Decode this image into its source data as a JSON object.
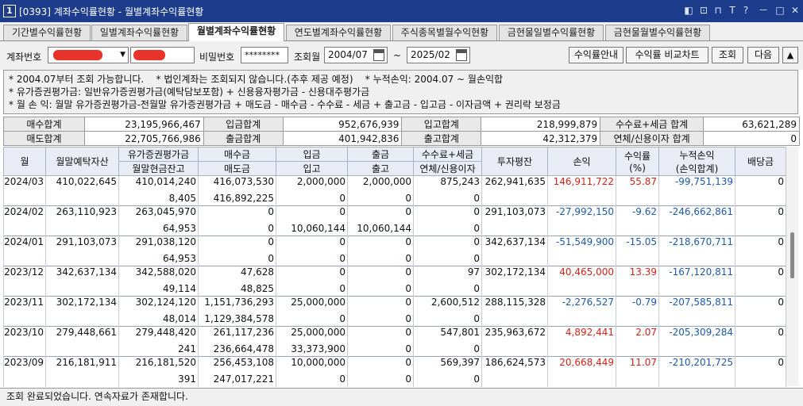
{
  "window": {
    "icon_text": "1",
    "title": "[0393] 계좌수익률현황 - 월별계좌수익률현황",
    "controls": [
      "◧",
      "⊡",
      "⊓",
      "T",
      "?",
      "－",
      "□",
      "✕"
    ]
  },
  "tabs": [
    {
      "label": "기간별수익률현황"
    },
    {
      "label": "일별계좌수익률현황"
    },
    {
      "label": "월별계좌수익률현황"
    },
    {
      "label": "연도별계좌수익률현황"
    },
    {
      "label": "주식종목별월수익현황"
    },
    {
      "label": "금현물일별수익률현황"
    },
    {
      "label": "금현물월별수익률현황"
    }
  ],
  "controls": {
    "account_label": "계좌번호",
    "password_label": "비밀번호",
    "password_value": "********",
    "period_label": "조회월",
    "date_from": "2004/07",
    "tilde": "~",
    "date_to": "2025/02",
    "btn_guide": "수익률안내",
    "btn_compare": "수익률 비교차트",
    "btn_query": "조회",
    "btn_next": "다음",
    "btn_up": "▲"
  },
  "notes": {
    "line1": "* 2004.07부터 조회 가능합니다.    * 법인계좌는 조회되지 않습니다.(추후 제공 예정)    * 누적손익: 2004.07 ~ 월손익합",
    "line2": "* 유가증권평가금: 일반유가증권평가금(예탁담보포함) + 신용융자평가금 - 신용대주평가금",
    "line3": "* 월 손 익: 월말 유가증권평가금-전월말 유가증권평가금 + 매도금 - 매수금 - 수수료 - 세금 + 출고금 - 입고금 - 이자금액 + 권리락 보정금"
  },
  "summary": {
    "row1": [
      {
        "label": "매수합계",
        "value": "23,195,966,467"
      },
      {
        "label": "입금합계",
        "value": "952,676,939"
      },
      {
        "label": "입고합계",
        "value": "218,999,879"
      },
      {
        "label": "수수료+세금 합계",
        "value": "63,621,289"
      }
    ],
    "row2": [
      {
        "label": "매도합계",
        "value": "22,705,766,986"
      },
      {
        "label": "출금합계",
        "value": "401,942,836"
      },
      {
        "label": "출고합계",
        "value": "42,312,379"
      },
      {
        "label": "연체/신용이자 합계",
        "value": "0"
      }
    ]
  },
  "grid": {
    "header_top": [
      "월",
      "월말예탁자산",
      "유가증권평가금",
      "매수금",
      "입금",
      "출금",
      "수수료+세금",
      "투자평잔",
      "손익",
      "수익률",
      "누적손익",
      "배당금"
    ],
    "header_bottom": [
      "월말현금잔고",
      "매도금",
      "입고",
      "출고",
      "연체/신용이자"
    ],
    "header_yield_sub": "(%)",
    "header_cum_sub": "(손익합계)",
    "rows": [
      {
        "month": "2024/03",
        "deposit": "410,022,645",
        "sec_eval": "410,014,240",
        "cash_bal": "8,405",
        "buy": "416,073,530",
        "sell": "416,892,225",
        "dep_in": "2,000,000",
        "stock_in": "0",
        "withdraw": "2,000,000",
        "stock_out": "0",
        "fee": "875,243",
        "interest": "0",
        "avg_inv": "262,941,635",
        "pnl": "146,911,722",
        "yield": "55.87",
        "cum": "-99,751,139",
        "dividend": "0"
      },
      {
        "month": "2024/02",
        "deposit": "263,110,923",
        "sec_eval": "263,045,970",
        "cash_bal": "64,953",
        "buy": "0",
        "sell": "0",
        "dep_in": "0",
        "stock_in": "10,060,144",
        "withdraw": "0",
        "stock_out": "10,060,144",
        "fee": "0",
        "interest": "0",
        "avg_inv": "291,103,073",
        "pnl": "-27,992,150",
        "yield": "-9.62",
        "cum": "-246,662,861",
        "dividend": "0"
      },
      {
        "month": "2024/01",
        "deposit": "291,103,073",
        "sec_eval": "291,038,120",
        "cash_bal": "64,953",
        "buy": "0",
        "sell": "0",
        "dep_in": "0",
        "stock_in": "0",
        "withdraw": "0",
        "stock_out": "0",
        "fee": "0",
        "interest": "0",
        "avg_inv": "342,637,134",
        "pnl": "-51,549,900",
        "yield": "-15.05",
        "cum": "-218,670,711",
        "dividend": "0"
      },
      {
        "month": "2023/12",
        "deposit": "342,637,134",
        "sec_eval": "342,588,020",
        "cash_bal": "49,114",
        "buy": "47,628",
        "sell": "48,825",
        "dep_in": "0",
        "stock_in": "0",
        "withdraw": "0",
        "stock_out": "0",
        "fee": "97",
        "interest": "0",
        "avg_inv": "302,172,134",
        "pnl": "40,465,000",
        "yield": "13.39",
        "cum": "-167,120,811",
        "dividend": "0"
      },
      {
        "month": "2023/11",
        "deposit": "302,172,134",
        "sec_eval": "302,124,120",
        "cash_bal": "48,014",
        "buy": "1,151,736,293",
        "sell": "1,129,384,578",
        "dep_in": "25,000,000",
        "stock_in": "0",
        "withdraw": "0",
        "stock_out": "0",
        "fee": "2,600,512",
        "interest": "0",
        "avg_inv": "288,115,328",
        "pnl": "-2,276,527",
        "yield": "-0.79",
        "cum": "-207,585,811",
        "dividend": "0"
      },
      {
        "month": "2023/10",
        "deposit": "279,448,661",
        "sec_eval": "279,448,420",
        "cash_bal": "241",
        "buy": "261,117,236",
        "sell": "236,664,478",
        "dep_in": "25,000,000",
        "stock_in": "33,373,900",
        "withdraw": "0",
        "stock_out": "0",
        "fee": "547,801",
        "interest": "0",
        "avg_inv": "235,963,672",
        "pnl": "4,892,441",
        "yield": "2.07",
        "cum": "-205,309,284",
        "dividend": "0"
      },
      {
        "month": "2023/09",
        "deposit": "216,181,911",
        "sec_eval": "216,181,520",
        "cash_bal": "391",
        "buy": "256,453,108",
        "sell": "247,017,221",
        "dep_in": "10,000,000",
        "stock_in": "0",
        "withdraw": "0",
        "stock_out": "0",
        "fee": "569,397",
        "interest": "0",
        "avg_inv": "186,624,573",
        "pnl": "20,668,449",
        "yield": "11.07",
        "cum": "-210,201,725",
        "dividend": "0"
      }
    ]
  },
  "status": {
    "text": "조회 완료되었습니다. 연속자료가 존재합니다."
  },
  "colors": {
    "title_bar": "#1e3c8c",
    "negative": "#1e5aa8",
    "positive": "#d0251b",
    "redaction": "#e8332b"
  }
}
